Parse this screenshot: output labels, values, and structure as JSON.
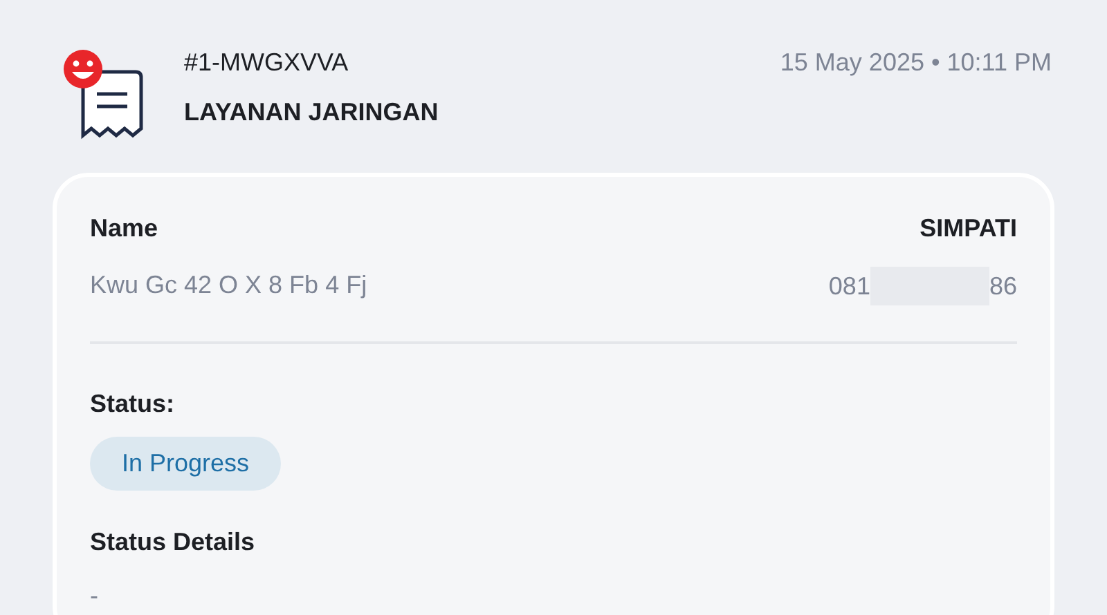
{
  "header": {
    "ticket_id": "#1-MWGXVVA",
    "category": "LAYANAN JARINGAN",
    "datetime": "15 May 2025 • 10:11 PM"
  },
  "customer": {
    "name_label": "Name",
    "name": "Kwu Gc 42 O X 8 Fb 4 Fj",
    "provider": "SIMPATI",
    "phone_start": "081",
    "phone_end": "86",
    "phone_redacted": true
  },
  "status": {
    "label": "Status:",
    "value": "In Progress",
    "kind": "progress"
  },
  "status_details": {
    "label": "Status Details",
    "value": "-"
  }
}
